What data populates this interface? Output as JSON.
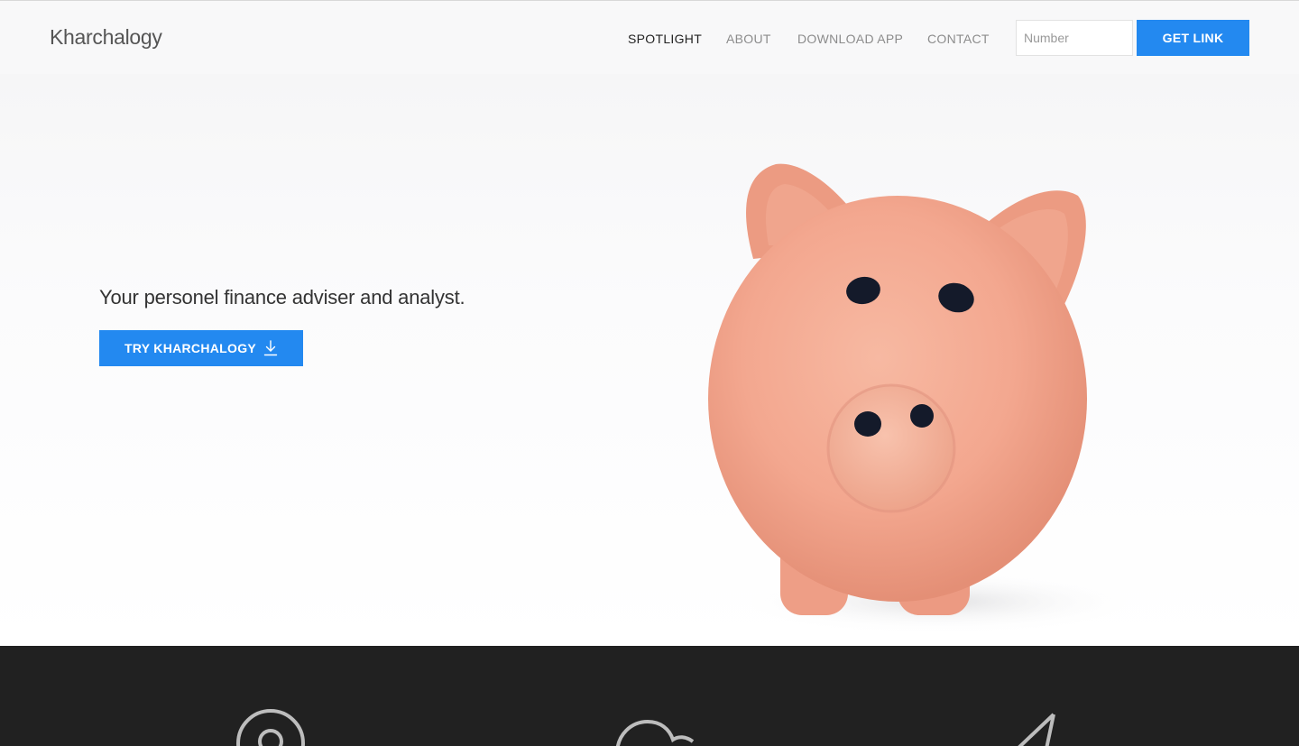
{
  "header": {
    "brand": "Kharchalogy",
    "nav": [
      {
        "label": "SPOTLIGHT",
        "active": true
      },
      {
        "label": "ABOUT",
        "active": false
      },
      {
        "label": "DOWNLOAD APP",
        "active": false
      },
      {
        "label": "CONTACT",
        "active": false
      }
    ],
    "number_placeholder": "Number",
    "get_link_label": "GET LINK"
  },
  "hero": {
    "tagline": "Your personel finance adviser and analyst.",
    "cta_label": "TRY KHARCHALOGY",
    "cta_icon": "download-arrow-icon",
    "image": "piggy-bank"
  },
  "features": {
    "icons": [
      "location-pin-icon",
      "cloud-icon",
      "paper-plane-icon"
    ]
  },
  "colors": {
    "accent": "#2389f0",
    "nav_active": "#222222",
    "nav_inactive": "#8c8c8c",
    "dark_band": "#212121"
  }
}
